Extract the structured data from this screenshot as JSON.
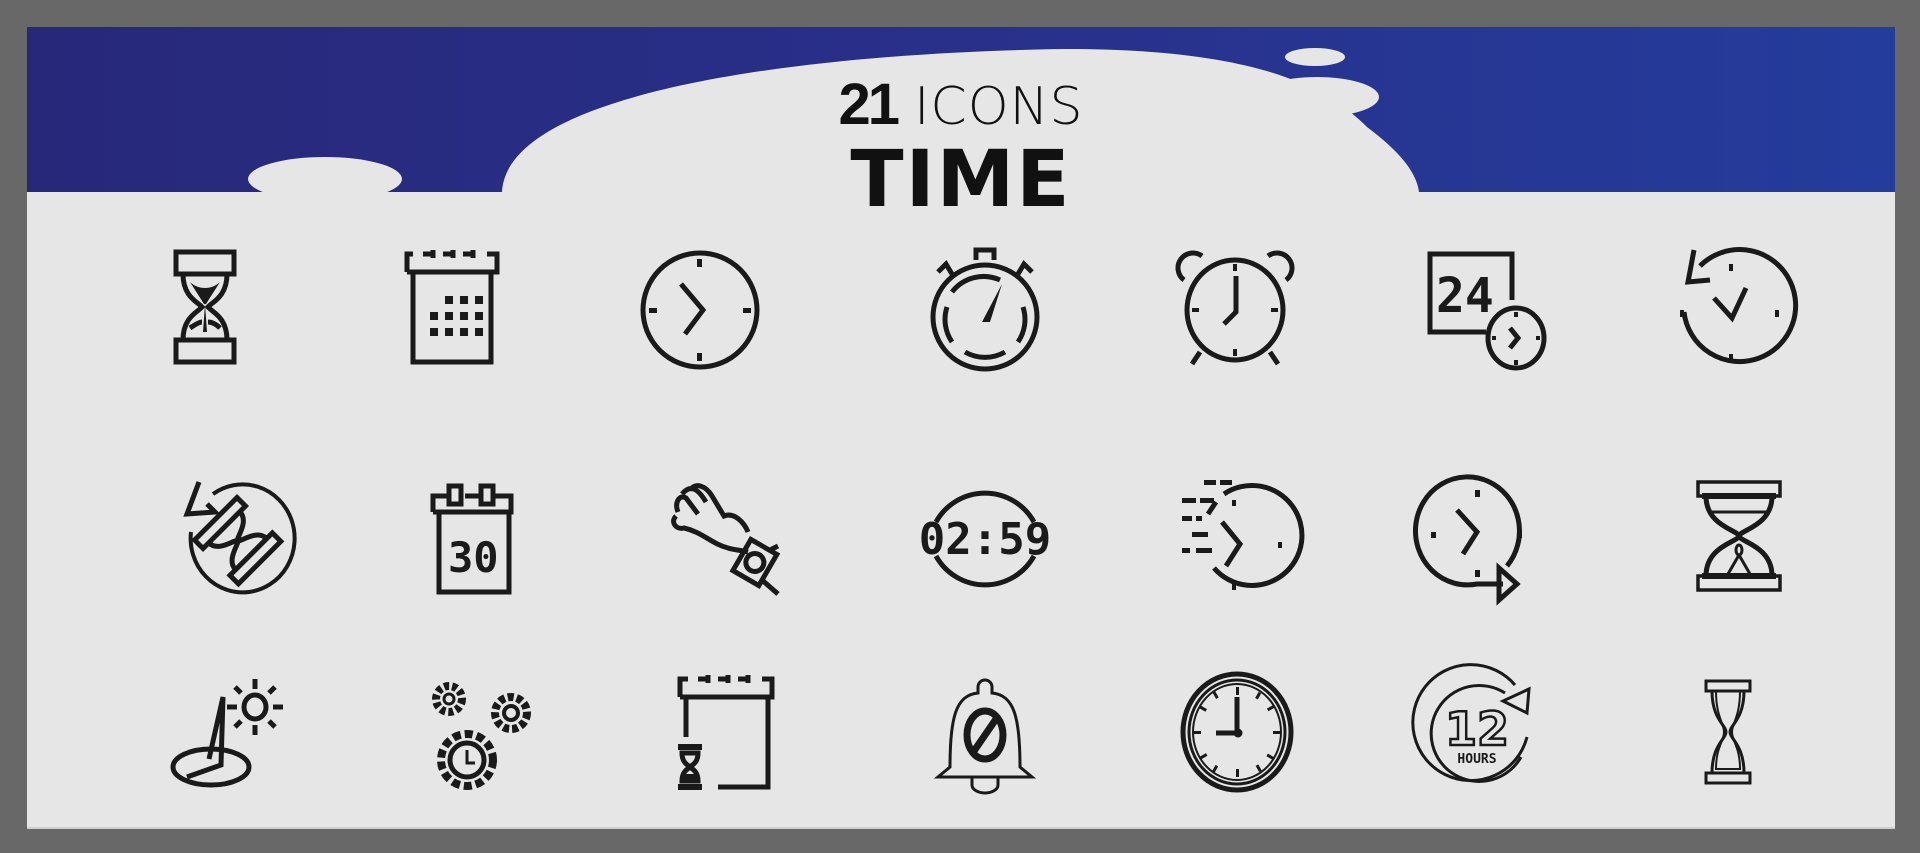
{
  "header": {
    "count": "21",
    "count_suffix": "ICONS",
    "title": "TIME"
  },
  "colors": {
    "frame": "#686868",
    "panel": "#e6e6e6",
    "banner_left": "#27287a",
    "banner_right": "#243c9c",
    "icon_stroke": "#1a1a1a"
  },
  "icons": [
    {
      "name": "hourglass-icon"
    },
    {
      "name": "calendar-grid-icon"
    },
    {
      "name": "wall-clock-icon"
    },
    {
      "name": "stopwatch-icon"
    },
    {
      "name": "alarm-clock-icon"
    },
    {
      "name": "24-hours-icon",
      "text": "24"
    },
    {
      "name": "clock-history-icon"
    },
    {
      "name": "hourglass-rotate-icon"
    },
    {
      "name": "calendar-day-icon",
      "text": "30"
    },
    {
      "name": "wristwatch-hand-icon"
    },
    {
      "name": "digital-timer-icon",
      "text": "02:59"
    },
    {
      "name": "fast-clock-icon"
    },
    {
      "name": "clock-forward-icon"
    },
    {
      "name": "hourglass-stand-icon"
    },
    {
      "name": "sundial-icon"
    },
    {
      "name": "gears-clock-icon"
    },
    {
      "name": "calendar-hourglass-icon"
    },
    {
      "name": "bell-off-icon"
    },
    {
      "name": "wall-clock-nine-icon"
    },
    {
      "name": "12-hours-icon",
      "text": "12",
      "subtext": "HOURS"
    },
    {
      "name": "sand-timer-icon"
    }
  ]
}
